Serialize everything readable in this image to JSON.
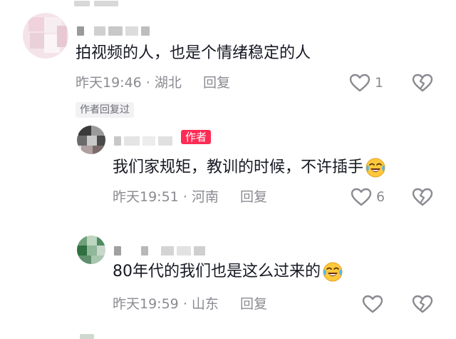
{
  "comments": [
    {
      "text": "拍视频的人，也是个情绪稳定的人",
      "time": "昨天19:46",
      "location": "湖北",
      "reply_label": "回复",
      "likes": "1",
      "replied_tag": "作者回复过"
    },
    {
      "text": "我们家规矩，教训的时候，不许插手",
      "time": "昨天19:51",
      "location": "河南",
      "reply_label": "回复",
      "likes": "6",
      "author_tag": "作者"
    },
    {
      "text": "80年代的我们也是这么过来的",
      "time": "昨天19:59",
      "location": "山东",
      "reply_label": "回复",
      "likes": ""
    }
  ],
  "meta_separator": "·",
  "colors": {
    "accent": "#fe2c55",
    "meta": "#8a8b91",
    "text": "#161823"
  },
  "icons": [
    "heart-outline-icon",
    "broken-heart-icon",
    "laughing-tears-emoji"
  ]
}
